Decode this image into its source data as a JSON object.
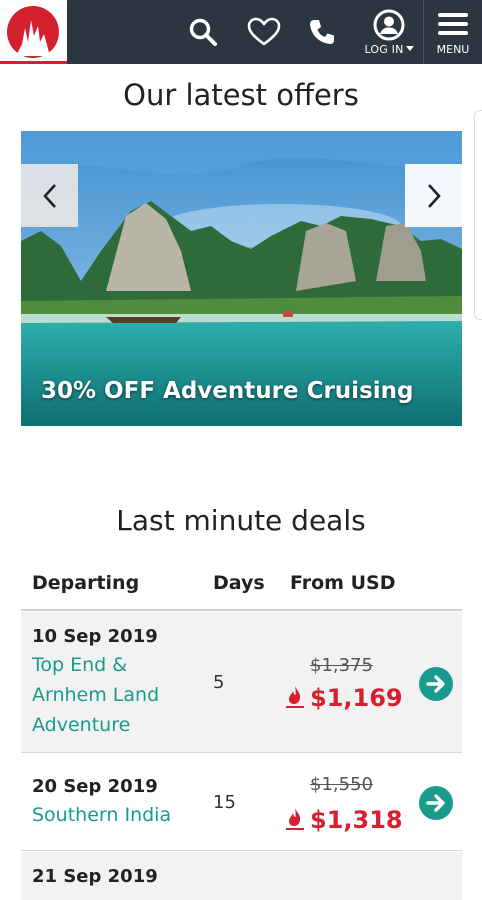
{
  "header": {
    "login_label": "LOG IN",
    "menu_label": "MENU",
    "brand_color": "#d4202f",
    "bar_color": "#2b3640",
    "icons": [
      "logo-icon",
      "search-icon",
      "heart-icon",
      "phone-icon",
      "user-icon",
      "menu-icon"
    ]
  },
  "offers": {
    "title": "Our latest offers",
    "slide_caption": "30% OFF Adventure Cruising",
    "prev_icon": "chevron-left-icon",
    "next_icon": "chevron-right-icon"
  },
  "deals": {
    "title": "Last minute deals",
    "columns": [
      "Departing",
      "Days",
      "From USD"
    ],
    "rows": [
      {
        "date": "10 Sep 2019",
        "name": "Top End & Arnhem Land Adventure",
        "days": "5",
        "old_price": "$1,375",
        "new_price": "$1,169"
      },
      {
        "date": "20 Sep 2019",
        "name": "Southern India",
        "days": "15",
        "old_price": "$1,550",
        "new_price": "$1,318"
      },
      {
        "date": "21 Sep 2019"
      }
    ],
    "link_color": "#1a9b8c",
    "price_color": "#d4202f"
  }
}
